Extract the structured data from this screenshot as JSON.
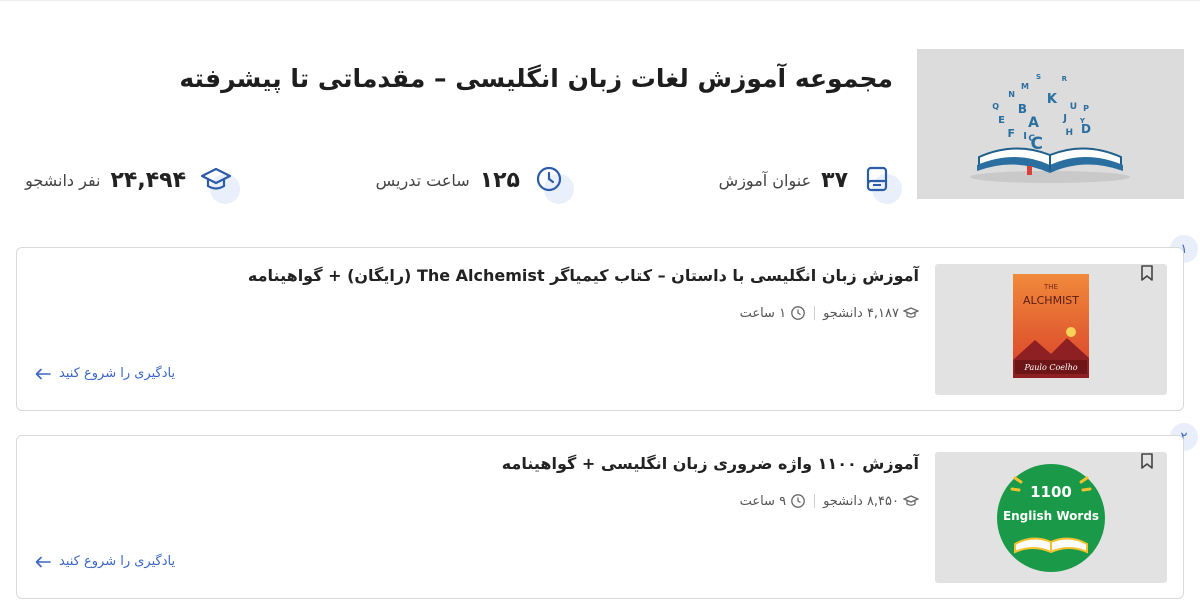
{
  "header": {
    "title": "مجموعه آموزش لغات زبان انگلیسی – مقدماتی تا پیشرفته",
    "cover_letters": [
      "Q",
      "N",
      "M",
      "S",
      "R",
      "E",
      "B",
      "K",
      "U",
      "F",
      "A",
      "J",
      "P",
      "I",
      "C",
      "H",
      "D",
      "C",
      "Y"
    ],
    "stats": {
      "courses": {
        "value": "۳۷",
        "label": "عنوان آموزش",
        "icon": "book-icon"
      },
      "hours": {
        "value": "۱۲۵",
        "label": "ساعت تدریس",
        "icon": "clock-icon"
      },
      "students": {
        "value": "۲۴,۴۹۴",
        "label": "نفر دانشجو",
        "icon": "graduation-cap-icon"
      }
    }
  },
  "courses": [
    {
      "index": "۱",
      "title": "آموزش زبان انگلیسی با داستان – کتاب کیمیاگر The Alchemist (رایگان) + گواهینامه",
      "students": "۴,۱۸۷ دانشجو",
      "hours": "۱ ساعت",
      "cta": "یادگیری را شروع کنید",
      "cover": {
        "top": "THE",
        "title": "ALCHMIST",
        "author": "Paulo Coelho"
      }
    },
    {
      "index": "۲",
      "title": "آموزش ۱۱۰۰ واژه ضروری زبان انگلیسی + گواهینامه",
      "students": "۸,۴۵۰ دانشجو",
      "hours": "۹ ساعت",
      "cta": "یادگیری را شروع کنید",
      "cover": {
        "number": "1100",
        "subtitle": "English Words"
      }
    }
  ],
  "colors": {
    "accent": "#3a66c4",
    "badge_bg": "#e8eefa",
    "card_border": "#d9d9d9",
    "thumb_bg": "#e2e2e2"
  }
}
